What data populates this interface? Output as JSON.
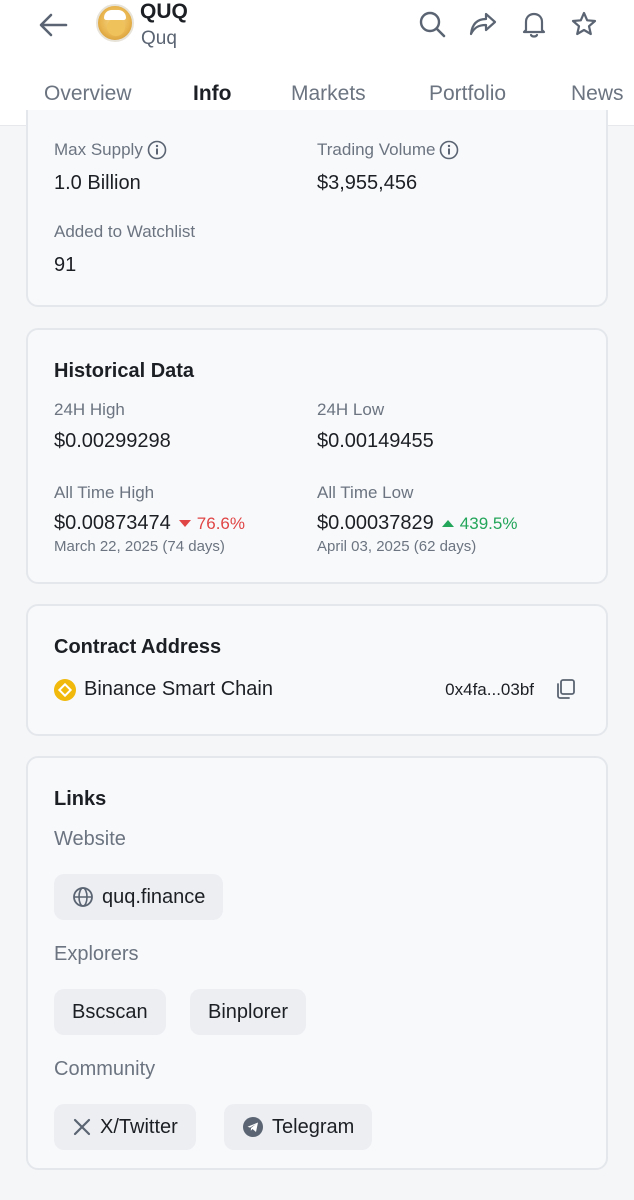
{
  "header": {
    "title": "QUQ",
    "subtitle": "Quq",
    "icons": [
      "back-arrow-icon",
      "search-icon",
      "share-icon",
      "bell-icon",
      "star-icon"
    ]
  },
  "tabs": [
    {
      "label": "Overview"
    },
    {
      "label": "Info"
    },
    {
      "label": "Markets"
    },
    {
      "label": "Portfolio"
    },
    {
      "label": "News"
    }
  ],
  "active_tab": "Info",
  "stats": {
    "max_supply_label": "Max Supply",
    "max_supply_value": "1.0 Billion",
    "trading_volume_label": "Trading Volume",
    "trading_volume_value": "$3,955,456",
    "watchlist_label": "Added to Watchlist",
    "watchlist_value": "91"
  },
  "historical": {
    "title": "Historical Data",
    "high24_label": "24H High",
    "high24_value": "$0.00299298",
    "low24_label": "24H Low",
    "low24_value": "$0.00149455",
    "ath_label": "All Time High",
    "ath_value": "$0.00873474",
    "ath_change": "76.6%",
    "ath_date": "March 22, 2025 (74 days)",
    "atl_label": "All Time Low",
    "atl_value": "$0.00037829",
    "atl_change": "439.5%",
    "atl_date": "April 03, 2025 (62 days)",
    "colors": {
      "down": "#e04545",
      "up": "#23a55a"
    }
  },
  "contract": {
    "title": "Contract Address",
    "chain": "Binance Smart Chain",
    "address": "0x4fa...03bf"
  },
  "links": {
    "title": "Links",
    "website_label": "Website",
    "website": "quq.finance",
    "explorers_label": "Explorers",
    "explorers": [
      "Bscscan",
      "Binplorer"
    ],
    "community_label": "Community",
    "community": [
      "X/Twitter",
      "Telegram"
    ]
  },
  "accent_color": "#39d06a"
}
